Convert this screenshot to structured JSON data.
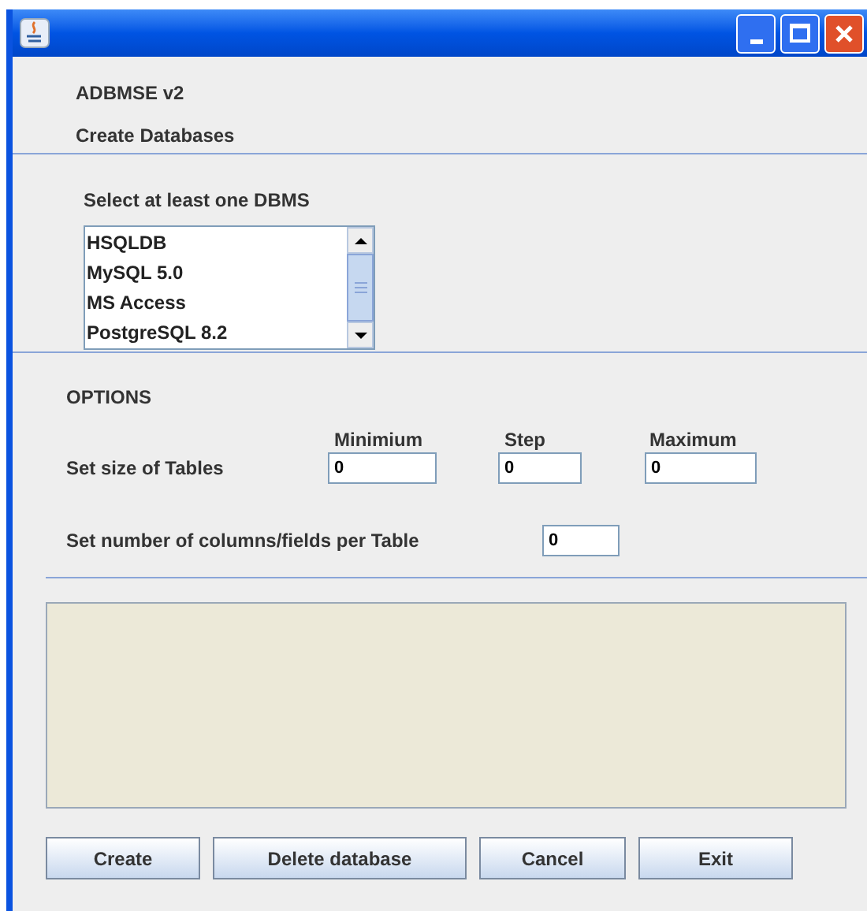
{
  "header": {
    "app_name": "ADBMSE v2",
    "subtitle": "Create Databases"
  },
  "dbms_list": {
    "label": "Select at least one DBMS",
    "items": [
      {
        "label": "HSQLDB",
        "selected": false
      },
      {
        "label": "MySQL 5.0",
        "selected": false
      },
      {
        "label": "MS Access",
        "selected": false
      },
      {
        "label": "PostgreSQL 8.2",
        "selected": false
      }
    ]
  },
  "options": {
    "title": "OPTIONS",
    "columns": [
      "Minimium",
      "Step",
      "Maximum"
    ],
    "table_size": {
      "label": "Set size of Tables",
      "values": [
        "0",
        "0",
        "0"
      ]
    },
    "columns_per_table": {
      "label": "Set number of columns/fields per Table",
      "value": "0"
    }
  },
  "buttons": [
    "Create",
    "Delete database",
    "Cancel",
    "Exit"
  ]
}
